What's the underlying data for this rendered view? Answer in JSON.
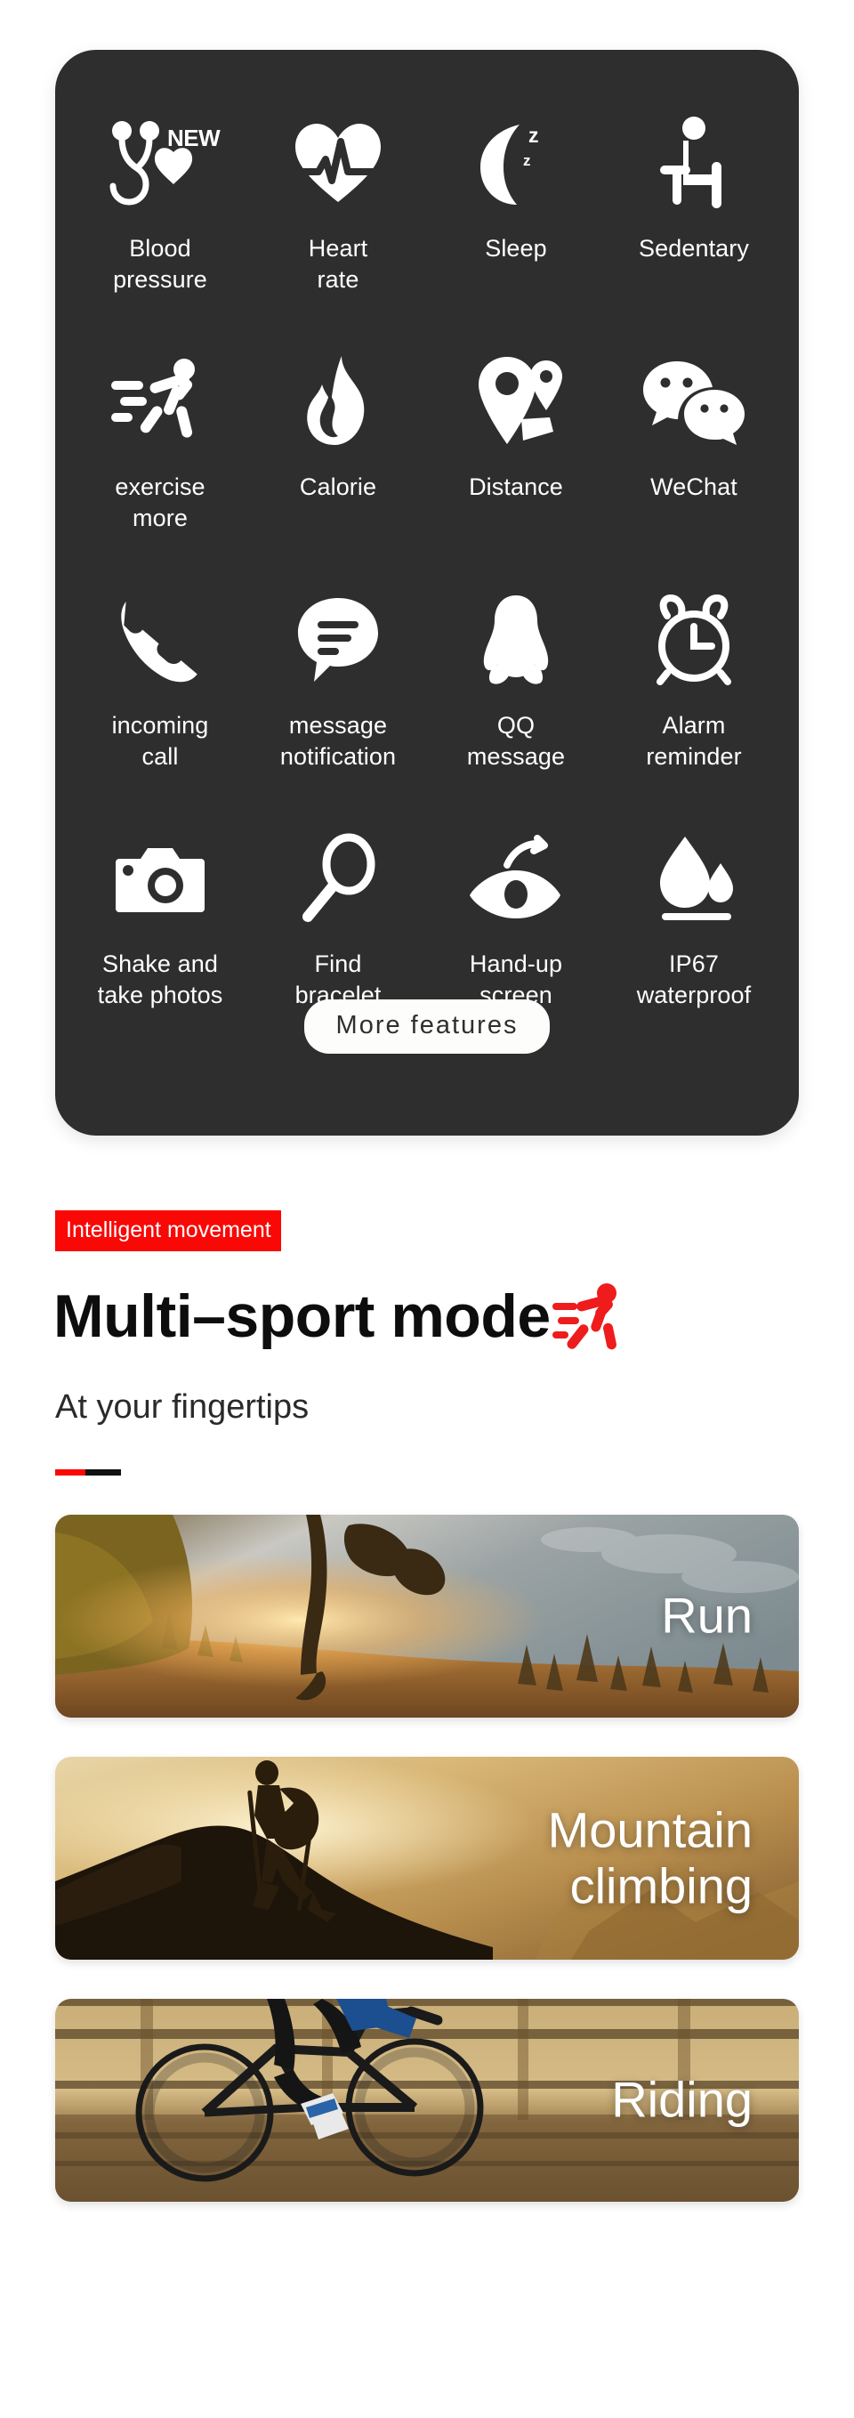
{
  "feature_panel": {
    "background_color": "#2e2e2e",
    "new_badge_text": "NEW",
    "more_features_label": "More features",
    "features": [
      {
        "icon": "blood-pressure-stethoscope-heart-icon",
        "label": "Blood\npressure",
        "badge": "NEW"
      },
      {
        "icon": "heart-rate-pulse-icon",
        "label": "Heart\nrate"
      },
      {
        "icon": "sleep-moon-zzz-icon",
        "label": "Sleep"
      },
      {
        "icon": "sedentary-sitting-person-icon",
        "label": "Sedentary"
      },
      {
        "icon": "exercise-running-person-icon",
        "label": "exercise\nmore"
      },
      {
        "icon": "calorie-flame-icon",
        "label": "Calorie"
      },
      {
        "icon": "distance-map-pin-icon",
        "label": "Distance"
      },
      {
        "icon": "wechat-bubbles-icon",
        "label": "WeChat"
      },
      {
        "icon": "incoming-call-handset-icon",
        "label": "incoming\ncall"
      },
      {
        "icon": "message-notification-bubble-icon",
        "label": "message\nnotification"
      },
      {
        "icon": "qq-penguin-icon",
        "label": "QQ\nmessage"
      },
      {
        "icon": "alarm-clock-icon",
        "label": "Alarm\nreminder"
      },
      {
        "icon": "camera-shutter-icon",
        "label": "Shake and\ntake photos"
      },
      {
        "icon": "magnifier-search-icon",
        "label": "Find\nbracelet"
      },
      {
        "icon": "hand-up-eye-icon",
        "label": "Hand-up\nscreen"
      },
      {
        "icon": "waterproof-droplet-icon",
        "label": "IP67\nwaterproof"
      }
    ]
  },
  "sport_section": {
    "tag": "Intelligent movement",
    "tag_color": "#fa0806",
    "headline": "Multi–sport mode",
    "headline_icon": "running-person-red-icon",
    "subhead": "At your fingertips",
    "divider_colors": {
      "red": "#fa0806",
      "black": "#111111"
    },
    "cards": [
      {
        "title": "Run",
        "art": "runner-on-trail-sunset-photo"
      },
      {
        "title": "Mountain\nclimbing",
        "art": "hiker-on-ridge-sunset-photo"
      },
      {
        "title": "Riding",
        "art": "road-cyclist-motion-photo"
      }
    ]
  }
}
